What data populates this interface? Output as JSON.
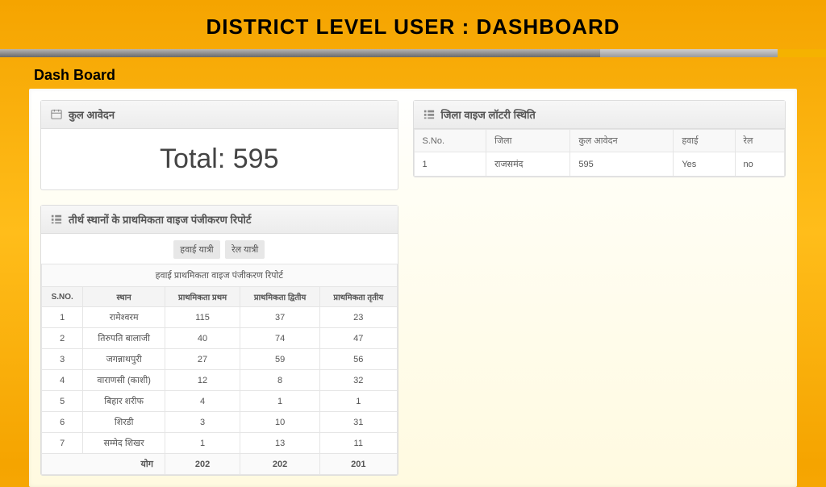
{
  "page": {
    "title": "DISTRICT LEVEL USER : DASHBOARD",
    "subhead": "Dash Board"
  },
  "total_panel": {
    "title": "कुल आवेदन",
    "total_label": "Total:",
    "total_value": "595"
  },
  "priority_panel": {
    "title": "तीर्थ स्थानों के प्राथमिकता वाइज पंजीकरण रिपोर्ट",
    "tabs": [
      "हवाई यात्री",
      "रेल यात्री"
    ],
    "caption": "हवाई प्राथमिकता वाइज पंजीकरण रिपोर्ट",
    "columns": [
      "S.NO.",
      "स्थान",
      "प्राथमिकता प्रथम",
      "प्राथमिकता द्वितीय",
      "प्राथमिकता तृतीय"
    ],
    "rows": [
      [
        "1",
        "रामेश्वरम",
        "115",
        "37",
        "23"
      ],
      [
        "2",
        "तिरुपति बालाजी",
        "40",
        "74",
        "47"
      ],
      [
        "3",
        "जगन्नाथपुरी",
        "27",
        "59",
        "56"
      ],
      [
        "4",
        "वाराणसी (काशी)",
        "12",
        "8",
        "32"
      ],
      [
        "5",
        "बिहार शरीफ",
        "4",
        "1",
        "1"
      ],
      [
        "6",
        "शिरडी",
        "3",
        "10",
        "31"
      ],
      [
        "7",
        "सम्मेद शिखर",
        "1",
        "13",
        "11"
      ]
    ],
    "total_label": "योग",
    "totals": [
      "202",
      "202",
      "201"
    ]
  },
  "lottery_panel": {
    "title": "जिला वाइज लॉटरी स्थिति",
    "columns": [
      "S.No.",
      "जिला",
      "कुल आवेदन",
      "हवाई",
      "रेल"
    ],
    "rows": [
      [
        "1",
        "राजसमंद",
        "595",
        "Yes",
        "no"
      ]
    ]
  }
}
